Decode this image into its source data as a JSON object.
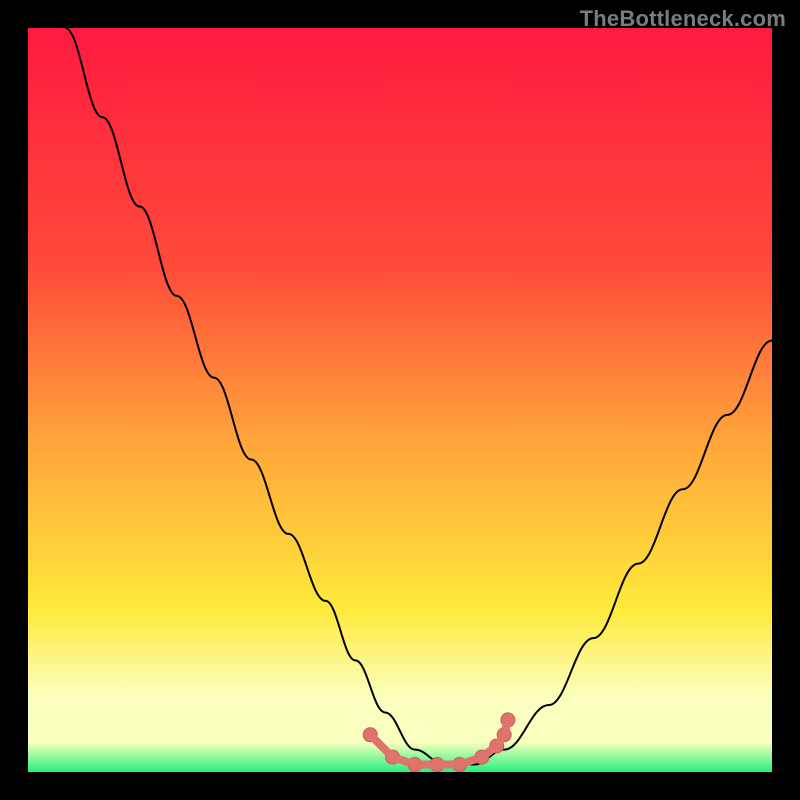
{
  "watermark": "TheBottleneck.com",
  "colors": {
    "border": "#000000",
    "gradient_top": "#ff1a3f",
    "gradient_mid_red": "#ff4a3a",
    "gradient_mid_orange": "#ffa33a",
    "gradient_yellow": "#ffe93a",
    "gradient_pale": "#faffbf",
    "gradient_bottom": "#25f07e",
    "curve": "#000000",
    "marker_fill": "#e0736e",
    "marker_stroke": "#c85a55"
  },
  "chart_data": {
    "type": "line",
    "title": "",
    "xlabel": "",
    "ylabel": "",
    "xlim": [
      0,
      100
    ],
    "ylim": [
      0,
      100
    ],
    "series": [
      {
        "name": "bottleneck-curve",
        "x": [
          5,
          10,
          15,
          20,
          25,
          30,
          35,
          40,
          44,
          48,
          52,
          56,
          60,
          64,
          70,
          76,
          82,
          88,
          94,
          100
        ],
        "y": [
          100,
          88,
          76,
          64,
          53,
          42,
          32,
          23,
          15,
          8,
          3,
          1,
          1,
          3,
          9,
          18,
          28,
          38,
          48,
          58
        ]
      }
    ],
    "markers": {
      "name": "highlight-points",
      "x": [
        46,
        49,
        52,
        55,
        58,
        61,
        63,
        64,
        64.5
      ],
      "y": [
        5,
        2,
        1,
        1,
        1,
        2,
        3.5,
        5,
        7
      ]
    },
    "gradient_stops_pct": [
      0,
      32,
      55,
      78,
      90,
      96,
      100
    ]
  }
}
